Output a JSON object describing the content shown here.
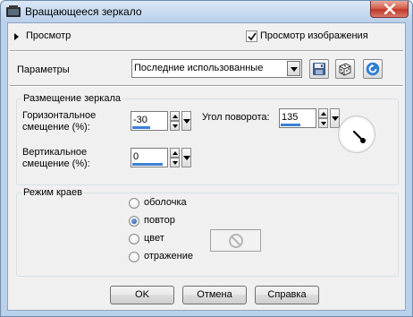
{
  "window": {
    "title": "Вращающееся зеркало"
  },
  "preview": {
    "label": "Просмотр",
    "image_preview_label": "Просмотр изображения",
    "image_preview_checked": true
  },
  "params": {
    "label": "Параметры",
    "preset_value": "Последние использованные"
  },
  "mirror_group": {
    "title": "Размещение зеркала",
    "h_offset_label": "Горизонтальное смещение (%):",
    "h_offset_value": "-30",
    "h_offset_bar_fraction": 0.5,
    "v_offset_label": "Вертикальное смещение (%):",
    "v_offset_value": "0",
    "v_offset_bar_fraction": 0.85,
    "rotation_label": "Угол поворота:",
    "rotation_value": "135",
    "rotation_bar_fraction": 0.55
  },
  "edge_group": {
    "title": "Режим краев",
    "options": [
      {
        "label": "оболочка",
        "checked": false
      },
      {
        "label": "повтор",
        "checked": true
      },
      {
        "label": "цвет",
        "checked": false
      },
      {
        "label": "отражение",
        "checked": false
      }
    ]
  },
  "buttons": {
    "ok": "OK",
    "cancel": "Отмена",
    "help": "Справка"
  },
  "icons": {
    "app": "app-icon",
    "close": "close-icon",
    "save": "save-icon",
    "random": "dice-icon",
    "reset": "reset-arrow-icon",
    "no_color": "no-color-icon"
  },
  "colors": {
    "close_red": "#c0392b",
    "accent_blue": "#3d7fd6"
  }
}
